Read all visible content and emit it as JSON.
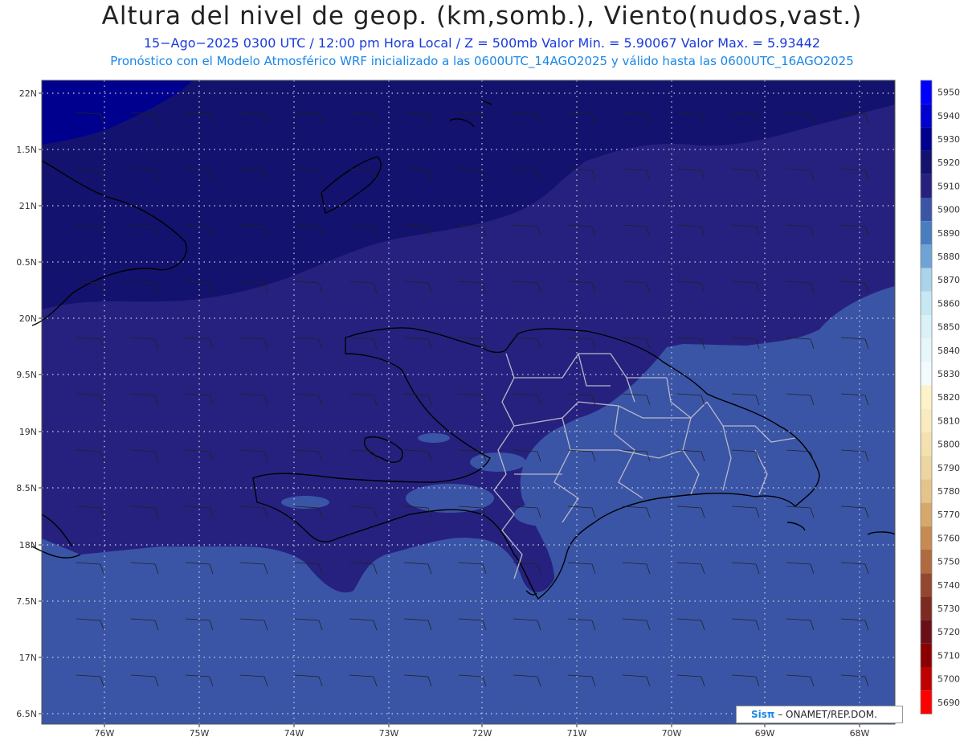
{
  "header": {
    "title": "Altura del nivel de geop. (km,somb.), Viento(nudos,vast.)",
    "line1": "15−Ago−2025  0300 UTC / 12:00 pm Hora Local / Z = 500mb    Valor Min. = 5.90067  Valor Max. = 5.93442",
    "line2": "Pronóstico con el Modelo Atmosférico WRF inicializado a las 0600UTC_14AGO2025 y válido hasta las  0600UTC_16AGO2025"
  },
  "axes": {
    "lat_labels": [
      "22N",
      "1.5N",
      "21N",
      "0.5N",
      "20N",
      "9.5N",
      "19N",
      "8.5N",
      "18N",
      "7.5N",
      "17N",
      "6.5N"
    ],
    "lon_labels": [
      "76W",
      "75W",
      "74W",
      "73W",
      "72W",
      "71W",
      "70W",
      "69W",
      "68W"
    ]
  },
  "colorbar": {
    "levels": [
      "5950",
      "5940",
      "5930",
      "5920",
      "5910",
      "5900",
      "5890",
      "5880",
      "5870",
      "5860",
      "5850",
      "5840",
      "5830",
      "5820",
      "5810",
      "5800",
      "5790",
      "5780",
      "5770",
      "5760",
      "5750",
      "5740",
      "5730",
      "5720",
      "5710",
      "5700",
      "5690"
    ],
    "colors": [
      "#0000ff",
      "#0000d0",
      "#00008f",
      "#13126e",
      "#26217f",
      "#3a55a6",
      "#4a7dbf",
      "#6fa3d6",
      "#a9d4ea",
      "#c6e8f2",
      "#daf2f7",
      "#e6f7fa",
      "#f2fbfd",
      "#fdf2c8",
      "#f9ebbd",
      "#f3e1b0",
      "#ecd5a0",
      "#e4c48a",
      "#d6a86c",
      "#c68a52",
      "#b06a40",
      "#94472f",
      "#7d2a22",
      "#6a0f18",
      "#8a0000",
      "#c00000",
      "#ff0000"
    ]
  },
  "map_colors": {
    "ocean_band_5910": "#26217f",
    "band_5900": "#3a55a6",
    "band_5920": "#13126e",
    "band_5930": "#00008f"
  },
  "credit": {
    "brand": "Sisπ",
    "org": "– ONAMET/REP.DOM."
  }
}
